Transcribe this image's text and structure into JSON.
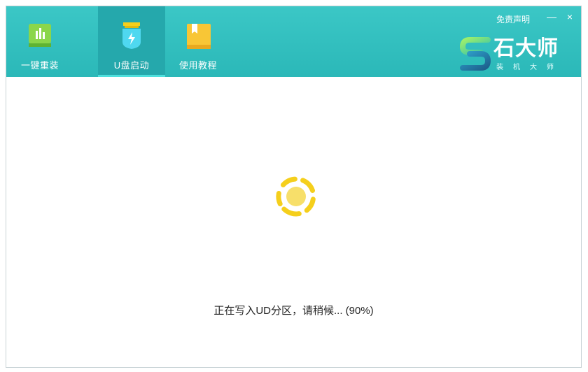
{
  "tabs": [
    {
      "label": "一键重装",
      "icon": "bar-chart-icon"
    },
    {
      "label": "U盘启动",
      "icon": "usb-drive-icon",
      "active": true
    },
    {
      "label": "使用教程",
      "icon": "book-icon"
    }
  ],
  "titlebar": {
    "disclaimer": "免责声明",
    "minimize": "—",
    "close": "×"
  },
  "brand": {
    "name": "石大师",
    "subtitle": "装机大师"
  },
  "status": {
    "message": "正在写入UD分区，请稍候... (90%)",
    "progress": 0.9
  },
  "colors": {
    "header": "#2bb8b8",
    "active_tab": "#25a8ac",
    "spinner": "#f5cf1c"
  }
}
